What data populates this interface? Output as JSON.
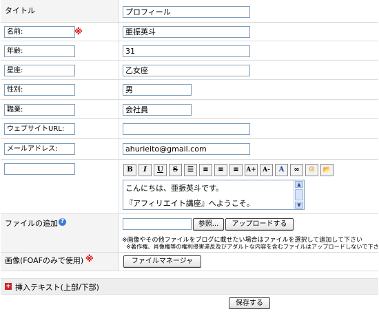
{
  "profile": {
    "title": {
      "label": "タイトル",
      "value": "プロフィール"
    },
    "fields": [
      {
        "label": "名前:",
        "value": "亜振英斗"
      },
      {
        "label": "年齢:",
        "value": "31"
      },
      {
        "label": "星座:",
        "value": "乙女座"
      },
      {
        "label": "性別:",
        "value": "男"
      },
      {
        "label": "職業:",
        "value": "会社員"
      },
      {
        "label": "ウェブサイトURL:",
        "value": ""
      },
      {
        "label": "メールアドレス:",
        "value": "ahurieito@gmail.com"
      },
      {
        "label": "",
        "value": ""
      }
    ],
    "required_mark": "※",
    "editor": {
      "toolbar": [
        "B",
        "I",
        "U",
        "S",
        "☰",
        "≡",
        "≡",
        "≡",
        "A+",
        "A-",
        "A",
        "∞",
        "☺",
        "📂"
      ],
      "text_line1": "こんにちは、亜振英斗です。",
      "text_line2": "『アフィリエイト講座』へようこそ。"
    },
    "file_add": {
      "label": "ファイルの追加",
      "help": "?",
      "browse_label": "参照...",
      "upload_label": "アップロードする",
      "note1": "※画像やその他ファイルをブログに載せたい場合はファイルを選択して追加して下さい",
      "note2": "※著作権、肖像権等の権利侵害違反及びアダルトな内容を含むファイルはアップロードしないで下さい"
    },
    "image_row": {
      "label": "画像(FOAFのみで使用)",
      "button_label": "ファイルマネージャ"
    },
    "insert_text": {
      "toggle": "+",
      "label": "挿入テキスト(上部/下部)"
    },
    "save_label": "保存する"
  }
}
